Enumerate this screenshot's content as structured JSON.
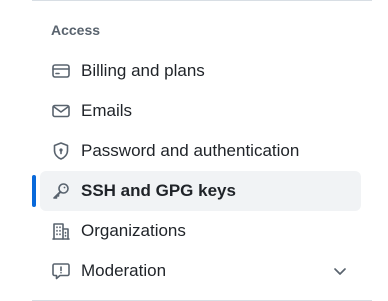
{
  "section": {
    "heading": "Access"
  },
  "nav": {
    "items": [
      {
        "label": "Billing and plans",
        "icon": "credit-card-icon",
        "active": false
      },
      {
        "label": "Emails",
        "icon": "mail-icon",
        "active": false
      },
      {
        "label": "Password and authentication",
        "icon": "shield-lock-icon",
        "active": false
      },
      {
        "label": "SSH and GPG keys",
        "icon": "key-icon",
        "active": true
      },
      {
        "label": "Organizations",
        "icon": "organization-icon",
        "active": false
      },
      {
        "label": "Moderation",
        "icon": "report-icon",
        "active": false,
        "expandable": true
      }
    ]
  },
  "colors": {
    "accent": "#0969da",
    "active_background": "#f1f3f5",
    "text": "#1f2328",
    "muted": "#59636e",
    "divider": "#d8dee4"
  }
}
